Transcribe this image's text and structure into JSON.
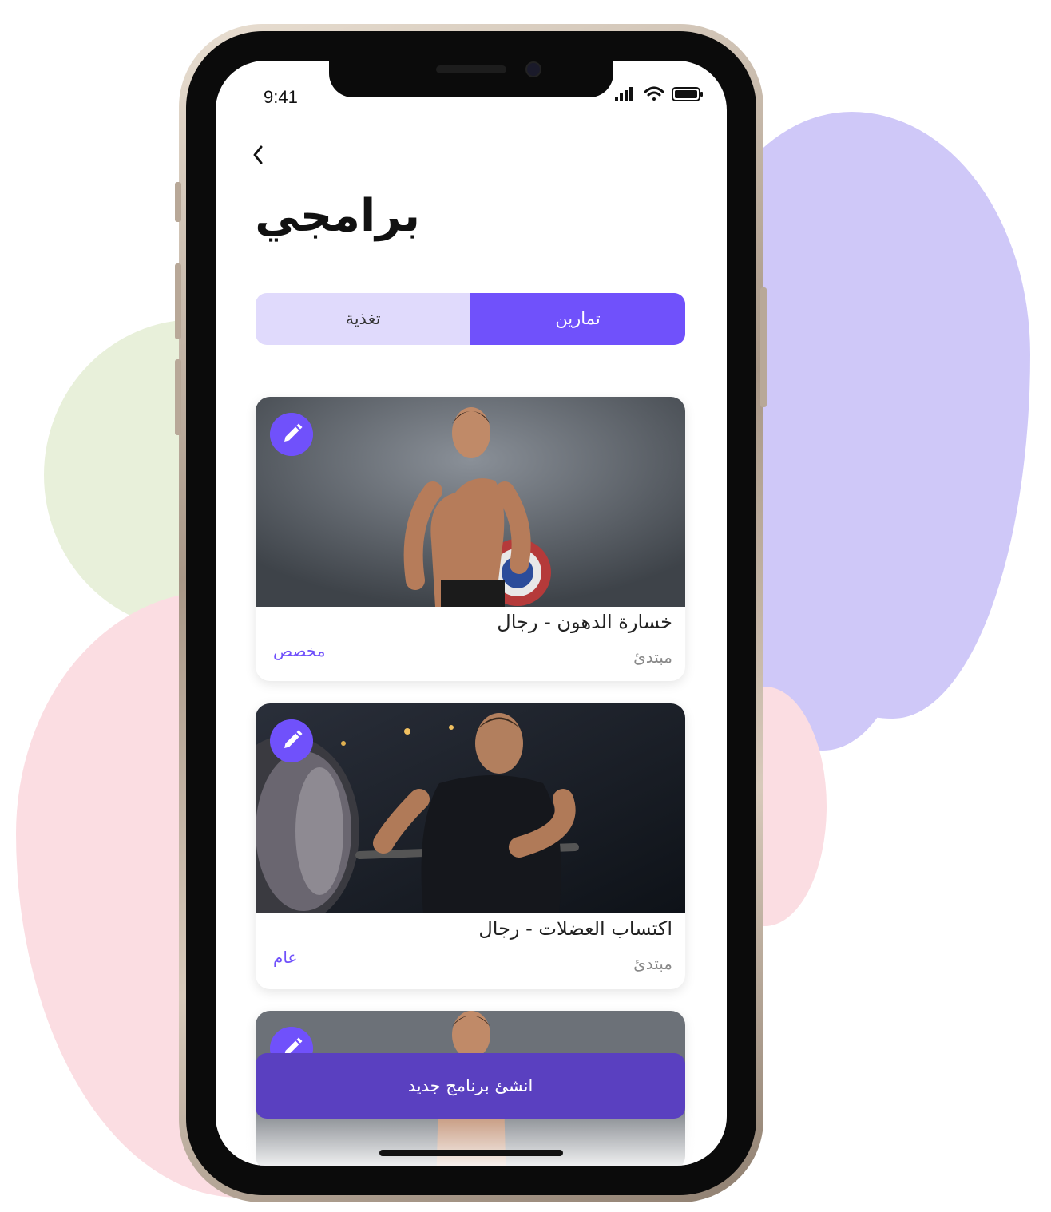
{
  "status_bar": {
    "time": "9:41"
  },
  "header": {
    "title": "برامجي"
  },
  "tabs": [
    {
      "label": "تمارين",
      "active": true
    },
    {
      "label": "تغذية",
      "active": false
    }
  ],
  "programs": [
    {
      "title": "خسارة الدهون - رجال",
      "level": "مبتدئ",
      "tag": "مخصص"
    },
    {
      "title": "اكتساب العضلات - رجال",
      "level": "مبتدئ",
      "tag": "عام"
    }
  ],
  "create_button": {
    "label": "انشئ برنامج جديد"
  },
  "colors": {
    "accent": "#7051fb",
    "button": "#5a40c0",
    "tab_bg": "#e0dafc"
  },
  "icons": [
    "back-chevron-icon",
    "pencil-edit-icon",
    "signal-icon",
    "wifi-icon",
    "battery-icon"
  ]
}
